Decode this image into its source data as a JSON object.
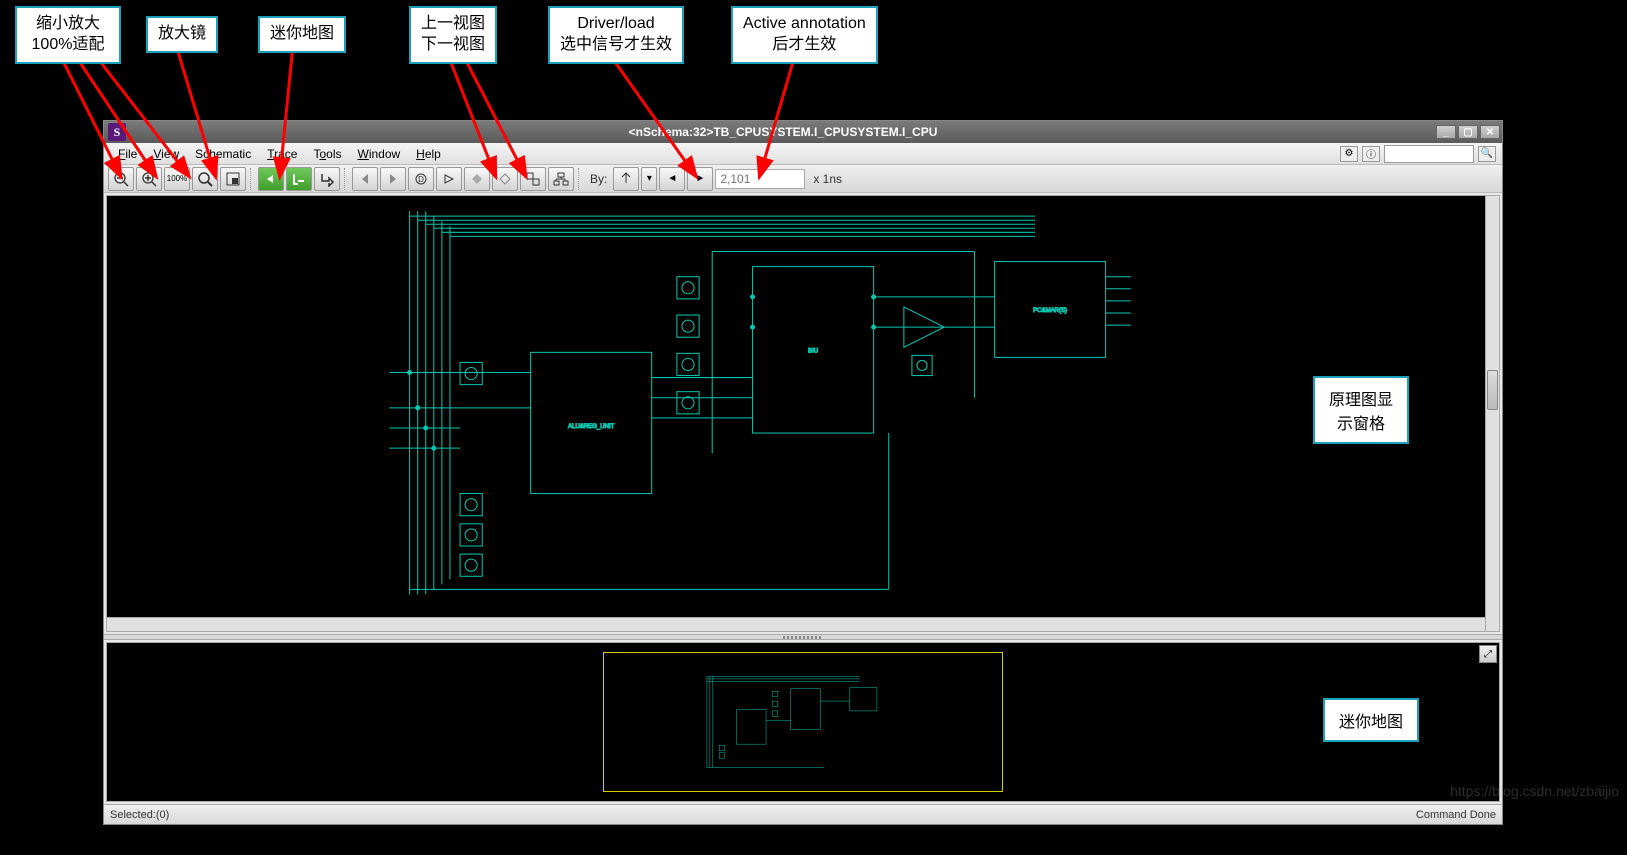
{
  "callouts": {
    "zoom": [
      "缩小放大",
      "100%适配"
    ],
    "magnifier": "放大镜",
    "minimap": "迷你地图",
    "views": [
      "上一视图",
      "下一视图"
    ],
    "driver": [
      "Driver/load",
      "选中信号才生效"
    ],
    "annotation": [
      "Active annotation",
      "后才生效"
    ],
    "schematic_pane": [
      "原理图显",
      "示窗格"
    ],
    "minimap_pane": "迷你地图"
  },
  "title": "<nSchema:32>TB_CPUSYSTEM.I_CPUSYSTEM.I_CPU",
  "app_icon_letter": "S",
  "menu": [
    "File",
    "View",
    "Schematic",
    "Trace",
    "Tools",
    "Window",
    "Help"
  ],
  "menu_mnemonic": [
    "F",
    "V",
    "S",
    "T",
    "T",
    "W",
    "H"
  ],
  "toolbar": {
    "zoom_100_label": "100%",
    "by_label": "By:",
    "time_placeholder": "2,101",
    "time_unit": "x 1ns"
  },
  "status": {
    "left": "Selected:(0)",
    "right": "Command Done"
  },
  "schematic_blocks": {
    "left_block": "ALU&REG_UNIT",
    "mid_block": "BIU",
    "right_block": "PC&MAR(S)"
  },
  "watermark": "https://blog.csdn.net/zbaijio"
}
